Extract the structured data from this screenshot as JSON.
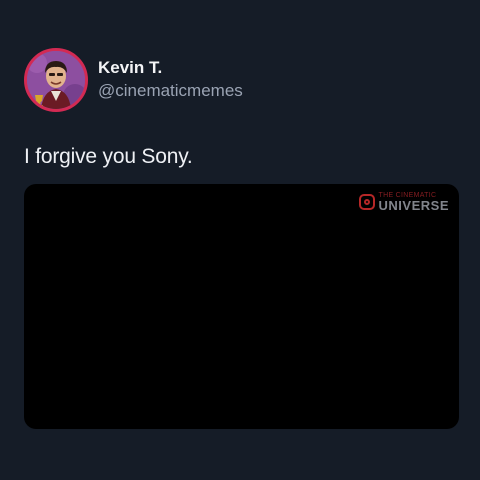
{
  "tweet": {
    "author": {
      "display_name": "Kevin T.",
      "handle": "@cinematicmemes",
      "avatar_icon": "cartoon-avatar-with-trophy",
      "avatar_border_color": "#d32a53"
    },
    "text": "I forgive you Sony.",
    "media": {
      "background_color": "#000000",
      "watermark": {
        "icon": "instagram-icon",
        "small_text": "THE CINEMATIC",
        "big_text": "UNIVERSE"
      }
    }
  },
  "colors": {
    "background": "#151c27",
    "text_primary": "#eef0f4",
    "text_secondary": "#9aa3b3"
  }
}
